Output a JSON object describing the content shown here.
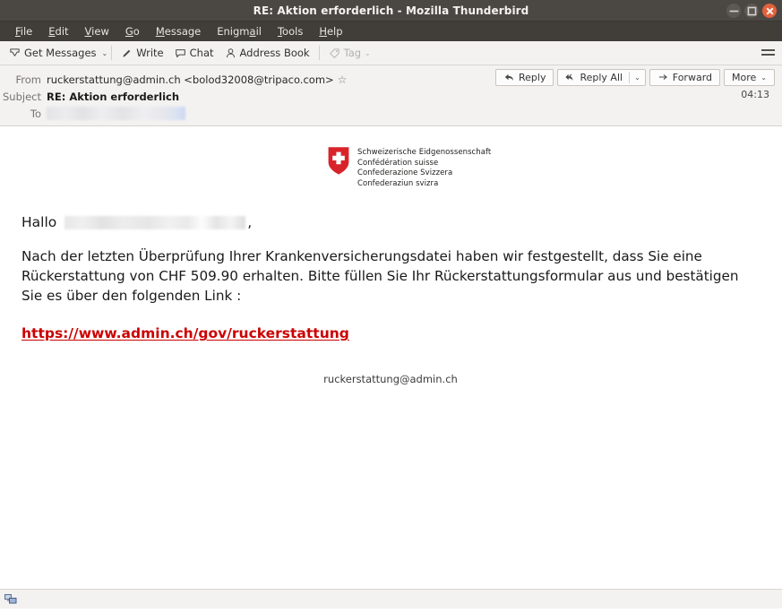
{
  "window": {
    "title": "RE: Aktion erforderlich - Mozilla Thunderbird",
    "controls": {
      "minimize": "–",
      "maximize": "□",
      "close": "×"
    }
  },
  "menubar": {
    "items": [
      {
        "label": "File",
        "accesskey": "F"
      },
      {
        "label": "Edit",
        "accesskey": "E"
      },
      {
        "label": "View",
        "accesskey": "V"
      },
      {
        "label": "Go",
        "accesskey": "G"
      },
      {
        "label": "Message",
        "accesskey": "M"
      },
      {
        "label": "Enigmail",
        "accesskey": "a"
      },
      {
        "label": "Tools",
        "accesskey": "T"
      },
      {
        "label": "Help",
        "accesskey": "H"
      }
    ]
  },
  "toolbar": {
    "get_messages": "Get Messages",
    "get_messages_icon": "download-arrow-icon",
    "get_messages_caret": "⌄",
    "write": "Write",
    "write_icon": "pencil-icon",
    "chat": "Chat",
    "chat_icon": "speech-bubble-icon",
    "address_book": "Address Book",
    "address_book_icon": "person-icon",
    "tag": "Tag",
    "tag_icon": "tag-icon",
    "tag_caret": "⌄",
    "app_menu_icon": "hamburger-menu-icon",
    "reply": "Reply",
    "reply_icon": "reply-arrow-icon",
    "reply_all": "Reply All",
    "reply_all_icon": "reply-all-arrow-icon",
    "reply_all_caret": "⌄",
    "forward": "Forward",
    "forward_icon": "forward-arrow-icon",
    "more": "More",
    "more_caret": "⌄"
  },
  "message_header": {
    "from_label": "From",
    "from_value": "ruckerstattung@admin.ch <bolod32008@tripaco.com>",
    "star_icon": "star-outline-icon",
    "subject_label": "Subject",
    "subject_value": "RE: Aktion erforderlich",
    "to_label": "To",
    "to_value": "",
    "timestamp": "04:13"
  },
  "message_body": {
    "logo": {
      "shield_icon": "swiss-coat-of-arms-icon",
      "shield_color": "#d8232a",
      "lines": [
        "Schweizerische Eidgenossenschaft",
        "Confédération suisse",
        "Confederazione Svizzera",
        "Confederaziun svizra"
      ]
    },
    "greeting_prefix": "Hallo",
    "greeting_name_redacted": "",
    "greeting_suffix": ",",
    "paragraph": "Nach der letzten Überprüfung Ihrer Krankenversicherungsdatei haben wir festgestellt, dass Sie eine Rückerstattung von CHF 509.90 erhalten. Bitte füllen Sie Ihr Rückerstattungsformular aus und bestätigen Sie es über den folgenden Link :",
    "link_text": "https://www.admin.ch/gov/ruckerstattung",
    "link_color": "#cc0000",
    "footer_email": "ruckerstattung@admin.ch"
  },
  "statusbar": {
    "network_icon": "network-connection-icon"
  }
}
